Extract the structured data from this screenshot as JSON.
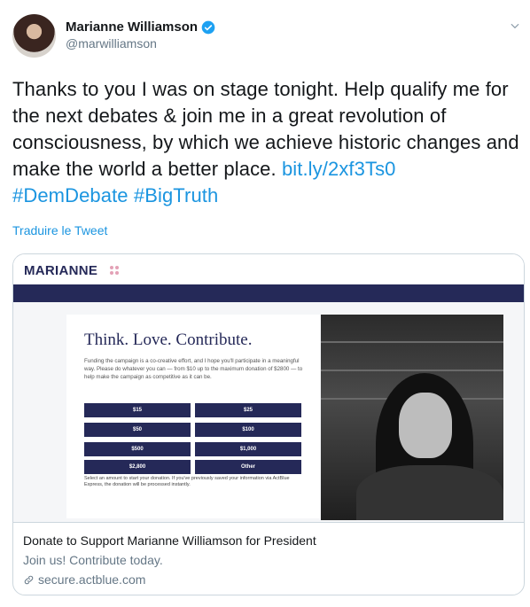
{
  "user": {
    "display_name": "Marianne Williamson",
    "handle": "@marwilliamson"
  },
  "tweet": {
    "text": "Thanks to you I was on stage tonight. Help qualify me for the next debates & join me in a great revolution of consciousness, by which we achieve historic changes and make the world a better place. ",
    "link": "bit.ly/2xf3Ts0",
    "hashtag1": "#DemDebate",
    "hashtag2": "#BigTruth"
  },
  "translate_label": "Traduire le Tweet",
  "card": {
    "brand": "MARIANNE",
    "headline": "Think. Love. Contribute.",
    "blurb": "Funding the campaign is a co-creative effort, and I hope you'll participate in a meaningful way. Please do whatever you can — from $10 up to the maximum donation of $2800 — to help make the campaign as competitive as it can be.",
    "amounts": [
      "$15",
      "$25",
      "$50",
      "$100",
      "$500",
      "$1,000",
      "$2,800",
      "Other"
    ],
    "note": "Select an amount to start your donation. If you've previously saved your information via ActBlue Express, the donation will be processed instantly.",
    "title": "Donate to Support Marianne Williamson for President",
    "description": "Join us! Contribute today.",
    "domain": "secure.actblue.com"
  },
  "colors": {
    "link": "#1b95e0",
    "navy": "#252958",
    "verified": "#1da1f2"
  }
}
